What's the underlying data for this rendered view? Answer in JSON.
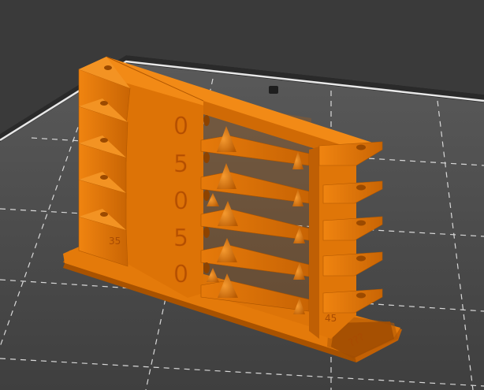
{
  "viewport": {
    "background_color": "#3a3a3a",
    "bed_color": "#4e4e4e",
    "grid_color": "#dcdcdc",
    "model_color": "#e07608",
    "model_shadow_color": "#a85200"
  },
  "model": {
    "engraved_digits": [
      "0",
      "5",
      "0",
      "5",
      "0"
    ],
    "angle_labels": {
      "left": "35",
      "right": "45"
    },
    "base_text": "???"
  }
}
